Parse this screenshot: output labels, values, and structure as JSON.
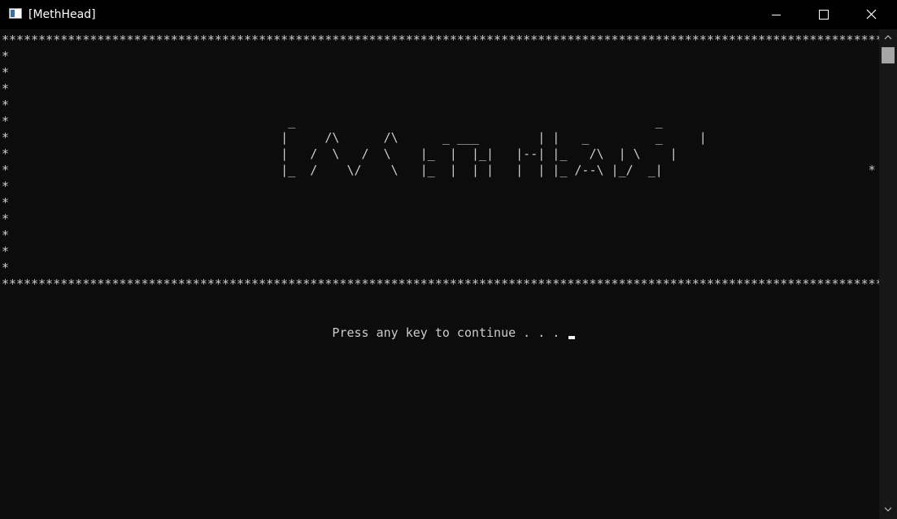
{
  "window": {
    "title": "[MethHead]",
    "icon": "console-window-icon",
    "controls": [
      "minimize-icon",
      "maximize-icon",
      "close-icon"
    ]
  },
  "console": {
    "lines": [
      "*****************************************************************************************************************************",
      "*                                                                                                                           *",
      "*                                                                                                                           *",
      "*                                                                                                                           *",
      "*                                                                                                                           *",
      "*                                      _                                                 _                                  *",
      "*                                     |     /\\      /\\      _ ___        | |   _         _     |                            *",
      "*                                     |   /  \\   /  \\    |_  |  |_|   |--| |_   /\\  | \\    |                            *",
      "*                                     |_  /    \\/    \\   |_  |  | |   |  | |_ /--\\ |_/  _|                            *",
      "*                                                                                                                           *",
      "*                                                                                                                           *",
      "*                                                                                                                           *",
      "*                                                                                                                           *",
      "*                                                                                                                           *",
      "*                                                                                                                           *",
      "*****************************************************************************************************************************",
      "",
      "",
      "                                             Press any key to continue . . . "
    ],
    "cursor": "block-cursor"
  },
  "colors": {
    "background": "#0c0c0c",
    "titlebar": "#000000",
    "text": "#cccccc"
  }
}
